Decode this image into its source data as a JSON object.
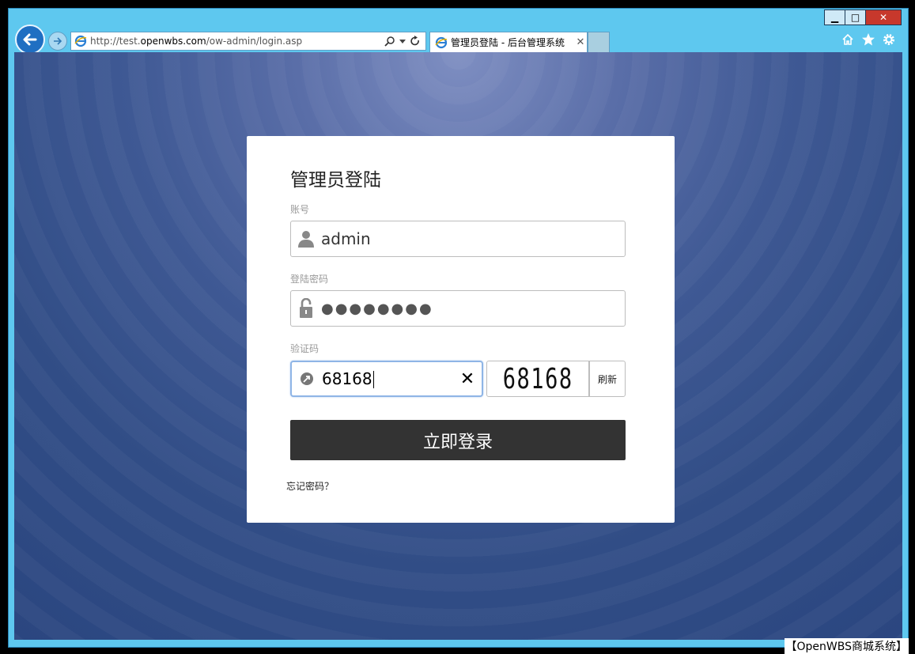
{
  "window": {
    "minimize": "▁",
    "maximize": "□",
    "close": "✕"
  },
  "browser": {
    "address": {
      "prefix": "http://test.",
      "host": "openwbs.com",
      "path": "/ow-admin/login.asp"
    },
    "tab": {
      "title": "管理员登陆 - 后台管理系统",
      "close": "✕"
    },
    "icons": {
      "back": "back-arrow-icon",
      "forward": "forward-arrow-icon",
      "search": "search-icon",
      "refresh": "refresh-icon",
      "home": "home-icon",
      "favorites": "star-icon",
      "settings": "gear-icon"
    }
  },
  "login": {
    "title": "管理员登陆",
    "account_label": "账号",
    "account_value": "admin",
    "password_label": "登陆密码",
    "password_value": "●●●●●●●●",
    "captcha_label": "验证码",
    "captcha_value": "68168",
    "captcha_image_text": "68168",
    "refresh_label": "刷新",
    "submit_label": "立即登录",
    "forgot_label": "忘记密码？",
    "clear_icon": "✕"
  },
  "watermark": "【OpenWBS商城系统】",
  "colors": {
    "frame": "#5ec8ef",
    "button": "#333333",
    "background": "#3f5994"
  }
}
